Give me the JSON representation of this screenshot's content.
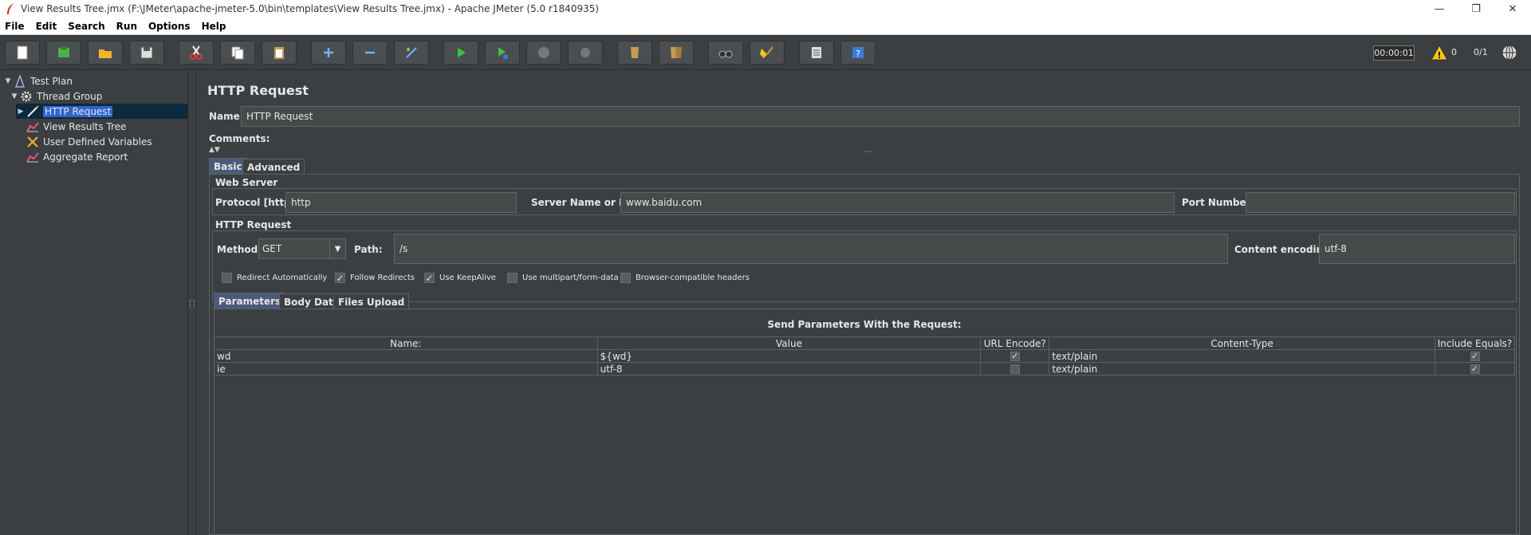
{
  "window": {
    "title": "View Results Tree.jmx (F:\\JMeter\\apache-jmeter-5.0\\bin\\templates\\View Results Tree.jmx) - Apache JMeter (5.0 r1840935)",
    "minimize": "—",
    "restore": "❐",
    "close": "✕"
  },
  "menu": [
    "File",
    "Edit",
    "Search",
    "Run",
    "Options",
    "Help"
  ],
  "toolbar": {
    "timer": "00:00:01",
    "warnings": "0",
    "threads": "0/1"
  },
  "tree": {
    "items": [
      {
        "label": "Test Plan"
      },
      {
        "label": "Thread Group"
      },
      {
        "label": "HTTP Request"
      },
      {
        "label": "View Results Tree"
      },
      {
        "label": "User Defined Variables"
      },
      {
        "label": "Aggregate Report"
      }
    ]
  },
  "panel": {
    "title": "HTTP Request",
    "name_label": "Name:",
    "name_value": "HTTP Request",
    "comments_label": "Comments:",
    "tabs": [
      "Basic",
      "Advanced"
    ],
    "web_server": {
      "section_label": "Web Server",
      "protocol_label": "Protocol [http]:",
      "protocol_value": "http",
      "server_label": "Server Name or IP:",
      "server_value": "www.baidu.com",
      "port_label": "Port Number:",
      "port_value": ""
    },
    "http_request": {
      "section_label": "HTTP Request",
      "method_label": "Method:",
      "method_value": "GET",
      "path_label": "Path:",
      "path_value": "/s",
      "encoding_label": "Content encoding:",
      "encoding_value": "utf-8"
    },
    "options": [
      {
        "label": "Redirect Automatically",
        "checked": false
      },
      {
        "label": "Follow Redirects",
        "checked": true
      },
      {
        "label": "Use KeepAlive",
        "checked": true
      },
      {
        "label": "Use multipart/form-data",
        "checked": false
      },
      {
        "label": "Browser-compatible headers",
        "checked": false
      }
    ],
    "sub_tabs": [
      "Parameters",
      "Body Data",
      "Files Upload"
    ],
    "params_caption": "Send Parameters With the Request:",
    "columns": [
      "Name:",
      "Value",
      "URL Encode?",
      "Content-Type",
      "Include Equals?"
    ],
    "rows": [
      {
        "name": "wd",
        "value": "${wd}",
        "encode": true,
        "content_type": "text/plain",
        "equals": true
      },
      {
        "name": "ie",
        "value": "utf-8",
        "encode": false,
        "content_type": "text/plain",
        "equals": true
      }
    ]
  }
}
